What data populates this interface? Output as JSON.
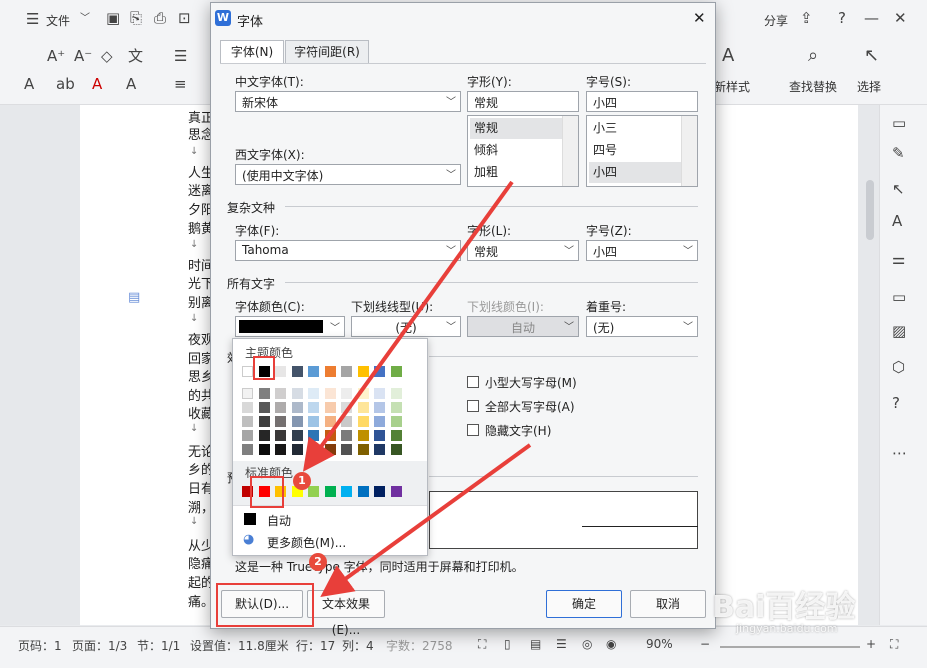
{
  "app": {
    "file_menu": "文件",
    "share": "分享",
    "toolbar_right": [
      "新样式",
      "查找替换",
      "选择"
    ]
  },
  "document": {
    "lines": [
      "真正",
      "思念",
      "人生",
      "迷离",
      "夕阳",
      "鹅黄",
      "时间",
      "光下",
      "别离",
      "夜观",
      "回家",
      "思乡",
      "的共",
      "收藏",
      "无论",
      "乡的",
      "日有",
      "溯，",
      "从少",
      "隐痛",
      "起的",
      "痛。"
    ]
  },
  "status": {
    "page_code": "页码：1",
    "page": "页面：1/3",
    "section": "节：1/1",
    "setting": "设置值：11.8厘米",
    "row": "行：17",
    "col": "列：4",
    "wordcount": "字数：2758",
    "zoom": "90%"
  },
  "dialog": {
    "title": "字体",
    "tabs": [
      "字体(N)",
      "字符间距(R)"
    ],
    "cn_font_label": "中文字体(T):",
    "cn_font_value": "新宋体",
    "style_label": "字形(Y):",
    "style_value": "常规",
    "style_options": [
      "常规",
      "倾斜",
      "加粗"
    ],
    "size_label": "字号(S):",
    "size_value": "小四",
    "size_options": [
      "小三",
      "四号",
      "小四"
    ],
    "west_font_label": "西文字体(X):",
    "west_font_value": "(使用中文字体)",
    "complex_section": "复杂文种",
    "complex_font_label": "字体(F):",
    "complex_font_value": "Tahoma",
    "complex_style_label": "字形(L):",
    "complex_style_value": "常规",
    "complex_size_label": "字号(Z):",
    "complex_size_value": "小四",
    "all_text_section": "所有文字",
    "color_label": "字体颜色(C):",
    "underline_label": "下划线线型(U):",
    "underline_value": "(无)",
    "underline_color_label": "下划线颜色(I):",
    "underline_color_value": "自动",
    "emphasis_label": "着重号:",
    "emphasis_value": "(无)",
    "effects_section_abbr": "效",
    "small_caps": "小型大写字母(M)",
    "all_caps": "全部大写字母(A)",
    "hidden": "隐藏文字(H)",
    "preview_section_abbr": "预",
    "footnote": "这是一种 TrueType 字体，同时适用于屏幕和打印机。",
    "default_button": "默认(D)...",
    "text_effect_button": "文本效果(E)...",
    "ok_button": "确定",
    "cancel_button": "取消"
  },
  "color_popup": {
    "theme_colors_label": "主题颜色",
    "standard_colors_label": "标准颜色",
    "auto_label": "自动",
    "more_colors_label": "更多颜色(M)...",
    "theme_top": [
      "#ffffff",
      "#000000",
      "#e7e6e6",
      "#44546a",
      "#5b9bd5",
      "#ed7d31",
      "#a5a5a5",
      "#ffc000",
      "#4472c4",
      "#70ad47"
    ],
    "theme_shades": [
      [
        "#f2f2f2",
        "#7f7f7f",
        "#d0cece",
        "#d6dce4",
        "#deebf6",
        "#fbe5d5",
        "#ededed",
        "#fff2cc",
        "#dae3f3",
        "#e2efda"
      ],
      [
        "#d8d8d8",
        "#595959",
        "#aeabab",
        "#adb9ca",
        "#bdd7ee",
        "#f7cbac",
        "#dbdbdb",
        "#fee599",
        "#b4c6e7",
        "#c5e0b3"
      ],
      [
        "#bfbfbf",
        "#3f3f3f",
        "#757070",
        "#8496b0",
        "#9cc3e5",
        "#f4b183",
        "#c9c9c9",
        "#ffd965",
        "#8eaadb",
        "#a8d08d"
      ],
      [
        "#a5a5a5",
        "#262626",
        "#3a3838",
        "#323f4f",
        "#2e75b5",
        "#c55a11",
        "#7b7b7b",
        "#bf9000",
        "#2f5496",
        "#538135"
      ],
      [
        "#7f7f7f",
        "#0c0c0c",
        "#171616",
        "#222a35",
        "#1e4e79",
        "#833c0b",
        "#525252",
        "#7f6000",
        "#1f3864",
        "#375623"
      ]
    ],
    "standard": [
      "#c00000",
      "#ff0000",
      "#ffc000",
      "#ffff00",
      "#92d050",
      "#00b050",
      "#00b0f0",
      "#0070c0",
      "#002060",
      "#7030a0"
    ]
  },
  "annotations": {
    "badge1": "1",
    "badge2": "2"
  },
  "watermark": {
    "text": "Bai百经验",
    "url": "jingyan.baidu.com"
  }
}
